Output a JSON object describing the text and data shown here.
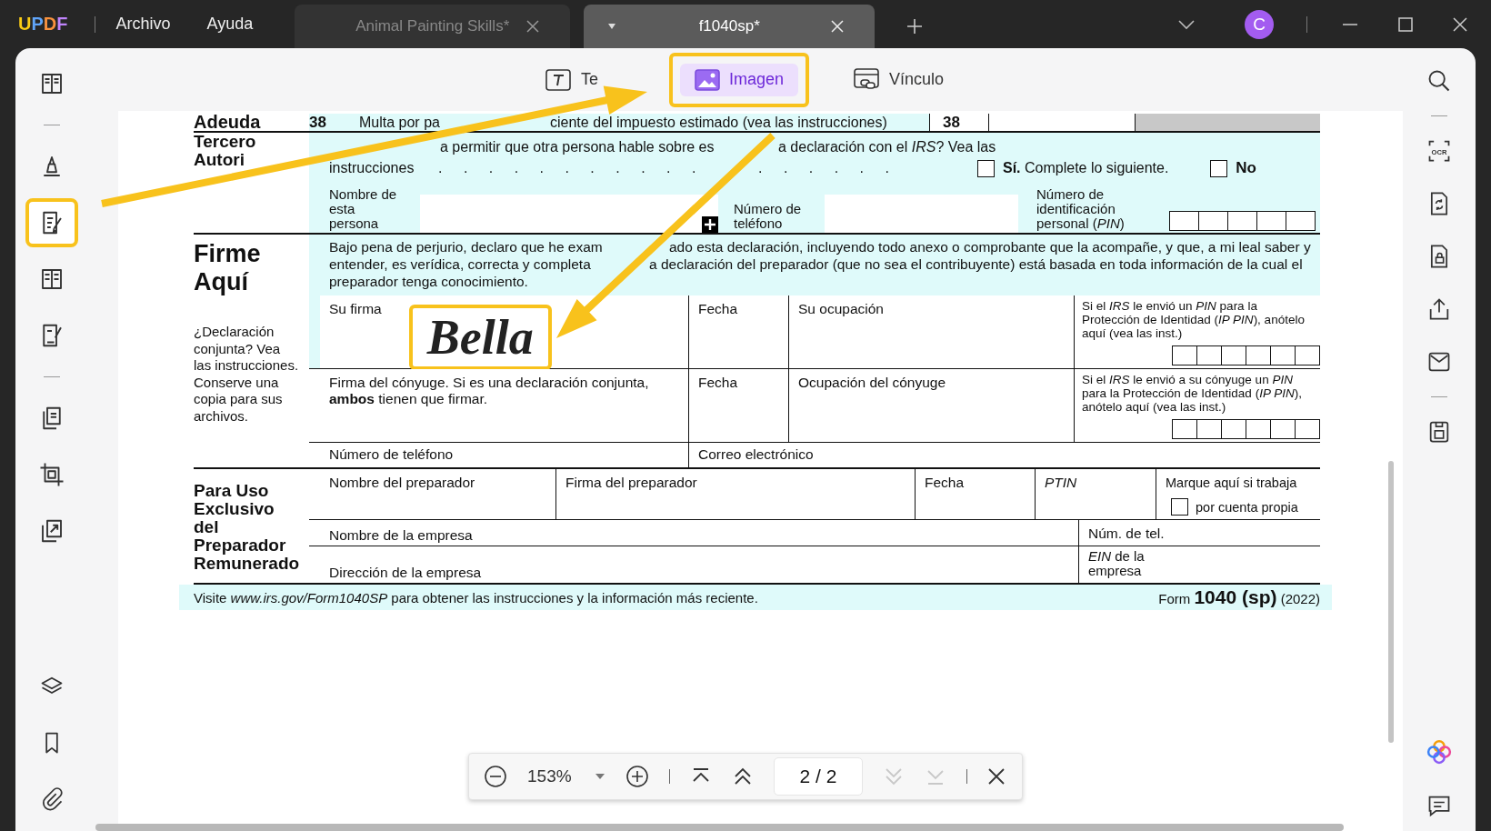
{
  "app": {
    "logo": "UPDF",
    "menu": [
      "Archivo",
      "Ayuda"
    ]
  },
  "tabs": [
    {
      "label": "Animal Painting Skills*",
      "selected": false
    },
    {
      "label": "f1040sp*",
      "selected": true
    }
  ],
  "avatar": "C",
  "left_tools": [
    {
      "selected": false
    },
    {
      "selected": false
    },
    {
      "selected": true
    },
    {
      "selected": false
    },
    {
      "selected": false
    },
    {
      "selected": false
    },
    {
      "selected": false
    },
    {
      "selected": false
    },
    {
      "selected": false
    },
    {
      "selected": false
    },
    {
      "selected": false
    }
  ],
  "edit_tools": [
    {
      "label": "Te",
      "selected": false
    },
    {
      "label": "Imagen",
      "selected": true
    },
    {
      "label": "Vínculo",
      "selected": false
    }
  ],
  "right_toolbar": {
    "ocr_label": "OCR"
  },
  "form": {
    "adeuda": {
      "label": "Adeuda",
      "line": "38",
      "parts": [
        "Multa por pa",
        "ciente del impuesto estimado (vea las instrucciones)"
      ],
      "box_line": "38"
    },
    "tercero": {
      "label": "Tercero",
      "label_parts": [
        "Autori"
      ],
      "question_parts": [
        "a permitir que otra persona hable sobre es",
        "a declaración con el *IRS*? Vea las"
      ],
      "question_line2": "instrucciones",
      "leader_parts": [
        ". . . . . . . . . . .",
        ". . . . . ."
      ],
      "yes": {
        "label": "**Sí.** Complete lo siguiente.",
        "checked": false
      },
      "no": {
        "label": "No",
        "checked": false
      },
      "name_label": [
        "Nombre de",
        "esta",
        "persona"
      ],
      "phone_label": [
        "Número de",
        "teléfono"
      ],
      "pin_label": [
        "Número de",
        "identificación",
        "personal (*PIN*)"
      ]
    },
    "firme": {
      "label": [
        "Firme",
        "Aquí"
      ],
      "note": "¿Declaración conjunta? Vea las instrucciones. Conserve una copia para sus archivos.",
      "perjury_lines": [
        [
          "Bajo pena de perjurio, declaro que he exam",
          "ado esta declaración, incluyendo todo anexo o comprobante que la acompañe, y que, a mi leal saber y"
        ],
        [
          "entender, es verídica, correcta y completa",
          "a declaración del preparador (que no sea el contribuyente) está basada en toda información de la cual el"
        ],
        [
          "preparador tenga conocimiento."
        ]
      ],
      "your_signature": "Su firma",
      "signature": "Bella",
      "date": "Fecha",
      "occupation": "Su ocupación",
      "ippin": "Si el *IRS* le envió un *PIN* para la Protección de Identidad (*IP PIN*), anótelo aquí (vea las inst.)",
      "spouse_signature": "Firma del cónyuge. Si es una declaración conjunta, **ambos** tienen que firmar.",
      "spouse_date": "Fecha",
      "spouse_occupation": "Ocupación del cónyuge",
      "spouse_ippin": "Si el *IRS* le envió a su cónyuge un *PIN* para la Protección de Identidad (*IP PIN*), anótelo aquí (vea las inst.)",
      "phone": "Número de teléfono",
      "email": "Correo electrónico"
    },
    "preparer": {
      "label": [
        "Para Uso",
        "Exclusivo",
        "del",
        "Preparador",
        "Remunerado"
      ],
      "name": "Nombre del preparador",
      "signature": "Firma del preparador",
      "date": "Fecha",
      "ptin": "PTIN",
      "self_employed": "Marque aquí si trabaja",
      "self_checkbox": {
        "label": "por cuenta propia",
        "checked": false
      },
      "firm": "Nombre de la empresa",
      "firm_phone": "Núm. de tel.",
      "address": "Dirección de la empresa",
      "ein": "*EIN* de la empresa"
    },
    "footer": {
      "visit": "Visite *www.irs.gov/Form1040SP* para obtener las instrucciones y la información más reciente.",
      "form": "Form **1040 (sp)** (2022)"
    }
  },
  "zoom_bar": {
    "zoom": "153%",
    "page": "2 / 2",
    "nav": [
      {
        "kind": "first",
        "disabled": false
      },
      {
        "kind": "prev",
        "disabled": false
      },
      {
        "kind": "next",
        "disabled": true
      },
      {
        "kind": "last",
        "disabled": true
      }
    ]
  }
}
